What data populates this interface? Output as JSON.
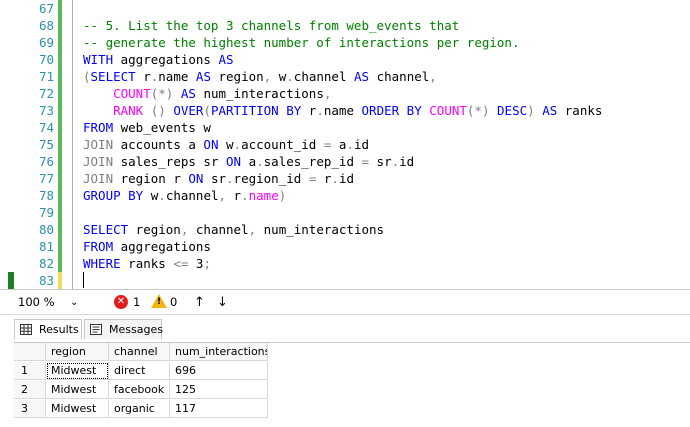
{
  "editor": {
    "lines": [
      {
        "num": "67",
        "tokens": []
      },
      {
        "num": "68",
        "tokens": [
          {
            "t": "-- 5. List the top 3 channels from web_events that",
            "c": "cm"
          }
        ]
      },
      {
        "num": "69",
        "tokens": [
          {
            "t": "-- generate the highest number of interactions per region.",
            "c": "cm"
          }
        ]
      },
      {
        "num": "70",
        "tokens": [
          {
            "t": "WITH",
            "c": "kw"
          },
          {
            "t": " aggregations ",
            "c": "id"
          },
          {
            "t": "AS",
            "c": "kw"
          }
        ]
      },
      {
        "num": "71",
        "tokens": [
          {
            "t": "(",
            "c": "gr"
          },
          {
            "t": "SELECT",
            "c": "kw"
          },
          {
            "t": " r",
            "c": "id"
          },
          {
            "t": ".",
            "c": "gr"
          },
          {
            "t": "name ",
            "c": "id"
          },
          {
            "t": "AS",
            "c": "kw"
          },
          {
            "t": " region",
            "c": "id"
          },
          {
            "t": ",",
            "c": "gr"
          },
          {
            "t": " w",
            "c": "id"
          },
          {
            "t": ".",
            "c": "gr"
          },
          {
            "t": "channel ",
            "c": "id"
          },
          {
            "t": "AS",
            "c": "kw"
          },
          {
            "t": " channel",
            "c": "id"
          },
          {
            "t": ",",
            "c": "gr"
          }
        ]
      },
      {
        "num": "72",
        "tokens": [
          {
            "t": "    ",
            "c": "id"
          },
          {
            "t": "COUNT",
            "c": "fn"
          },
          {
            "t": "(*)",
            "c": "gr"
          },
          {
            "t": " ",
            "c": "id"
          },
          {
            "t": "AS",
            "c": "kw"
          },
          {
            "t": " num_interactions",
            "c": "id"
          },
          {
            "t": ",",
            "c": "gr"
          }
        ]
      },
      {
        "num": "73",
        "tokens": [
          {
            "t": "    ",
            "c": "id"
          },
          {
            "t": "RANK",
            "c": "fn"
          },
          {
            "t": " () ",
            "c": "gr"
          },
          {
            "t": "OVER",
            "c": "kw"
          },
          {
            "t": "(",
            "c": "gr"
          },
          {
            "t": "PARTITION BY",
            "c": "kw"
          },
          {
            "t": " r",
            "c": "id"
          },
          {
            "t": ".",
            "c": "gr"
          },
          {
            "t": "name ",
            "c": "id"
          },
          {
            "t": "ORDER BY",
            "c": "kw"
          },
          {
            "t": " ",
            "c": "id"
          },
          {
            "t": "COUNT",
            "c": "fn"
          },
          {
            "t": "(*)",
            "c": "gr"
          },
          {
            "t": " ",
            "c": "id"
          },
          {
            "t": "DESC",
            "c": "kw"
          },
          {
            "t": ")",
            "c": "gr"
          },
          {
            "t": " ",
            "c": "id"
          },
          {
            "t": "AS",
            "c": "kw"
          },
          {
            "t": " ranks",
            "c": "id"
          }
        ]
      },
      {
        "num": "74",
        "tokens": [
          {
            "t": "FROM",
            "c": "kw"
          },
          {
            "t": " web_events w",
            "c": "id"
          }
        ]
      },
      {
        "num": "75",
        "tokens": [
          {
            "t": "JOIN",
            "c": "gr"
          },
          {
            "t": " accounts a ",
            "c": "id"
          },
          {
            "t": "ON",
            "c": "kw"
          },
          {
            "t": " w",
            "c": "id"
          },
          {
            "t": ".",
            "c": "gr"
          },
          {
            "t": "account_id ",
            "c": "id"
          },
          {
            "t": "=",
            "c": "gr"
          },
          {
            "t": " a",
            "c": "id"
          },
          {
            "t": ".",
            "c": "gr"
          },
          {
            "t": "id",
            "c": "id"
          }
        ]
      },
      {
        "num": "76",
        "tokens": [
          {
            "t": "JOIN",
            "c": "gr"
          },
          {
            "t": " sales_reps sr ",
            "c": "id"
          },
          {
            "t": "ON",
            "c": "kw"
          },
          {
            "t": " a",
            "c": "id"
          },
          {
            "t": ".",
            "c": "gr"
          },
          {
            "t": "sales_rep_id ",
            "c": "id"
          },
          {
            "t": "=",
            "c": "gr"
          },
          {
            "t": " sr",
            "c": "id"
          },
          {
            "t": ".",
            "c": "gr"
          },
          {
            "t": "id",
            "c": "id"
          }
        ]
      },
      {
        "num": "77",
        "tokens": [
          {
            "t": "JOIN",
            "c": "gr"
          },
          {
            "t": " region r ",
            "c": "id"
          },
          {
            "t": "ON",
            "c": "kw"
          },
          {
            "t": " sr",
            "c": "id"
          },
          {
            "t": ".",
            "c": "gr"
          },
          {
            "t": "region_id ",
            "c": "id"
          },
          {
            "t": "=",
            "c": "gr"
          },
          {
            "t": " r",
            "c": "id"
          },
          {
            "t": ".",
            "c": "gr"
          },
          {
            "t": "id",
            "c": "id"
          }
        ]
      },
      {
        "num": "78",
        "tokens": [
          {
            "t": "GROUP BY",
            "c": "kw"
          },
          {
            "t": " w",
            "c": "id"
          },
          {
            "t": ".",
            "c": "gr"
          },
          {
            "t": "channel",
            "c": "id"
          },
          {
            "t": ",",
            "c": "gr"
          },
          {
            "t": " r",
            "c": "id"
          },
          {
            "t": ".",
            "c": "gr"
          },
          {
            "t": "name",
            "c": "fn"
          },
          {
            "t": ")",
            "c": "gr"
          }
        ]
      },
      {
        "num": "79",
        "tokens": []
      },
      {
        "num": "80",
        "tokens": [
          {
            "t": "SELECT",
            "c": "kw"
          },
          {
            "t": " region",
            "c": "id"
          },
          {
            "t": ",",
            "c": "gr"
          },
          {
            "t": " channel",
            "c": "id"
          },
          {
            "t": ",",
            "c": "gr"
          },
          {
            "t": " num_interactions",
            "c": "id"
          }
        ]
      },
      {
        "num": "81",
        "tokens": [
          {
            "t": "FROM",
            "c": "kw"
          },
          {
            "t": " aggregations",
            "c": "id"
          }
        ]
      },
      {
        "num": "82",
        "tokens": [
          {
            "t": "WHERE",
            "c": "kw"
          },
          {
            "t": " ranks ",
            "c": "id"
          },
          {
            "t": "<=",
            "c": "gr"
          },
          {
            "t": " 3",
            "c": "id"
          },
          {
            "t": ";",
            "c": "gr"
          }
        ]
      },
      {
        "num": "83",
        "tokens": []
      }
    ],
    "colors": {
      "keyword": "#0000ff",
      "function": "#ff00ff",
      "comment": "#008000",
      "operator": "#808080",
      "line_number": "#2b91af"
    }
  },
  "statusbar": {
    "zoom": "100 %",
    "zoom_arrow_icon": "chevron-down-icon",
    "errors": "1",
    "warnings": "0",
    "nav_up_icon": "arrow-up-icon",
    "nav_down_icon": "arrow-down-icon"
  },
  "tabs": {
    "results": "Results",
    "messages": "Messages"
  },
  "grid": {
    "columns": [
      "region",
      "channel",
      "num_interactions"
    ],
    "rows": [
      {
        "n": "1",
        "cells": [
          "Midwest",
          "direct",
          "696"
        ]
      },
      {
        "n": "2",
        "cells": [
          "Midwest",
          "facebook",
          "125"
        ]
      },
      {
        "n": "3",
        "cells": [
          "Midwest",
          "organic",
          "117"
        ]
      }
    ]
  }
}
